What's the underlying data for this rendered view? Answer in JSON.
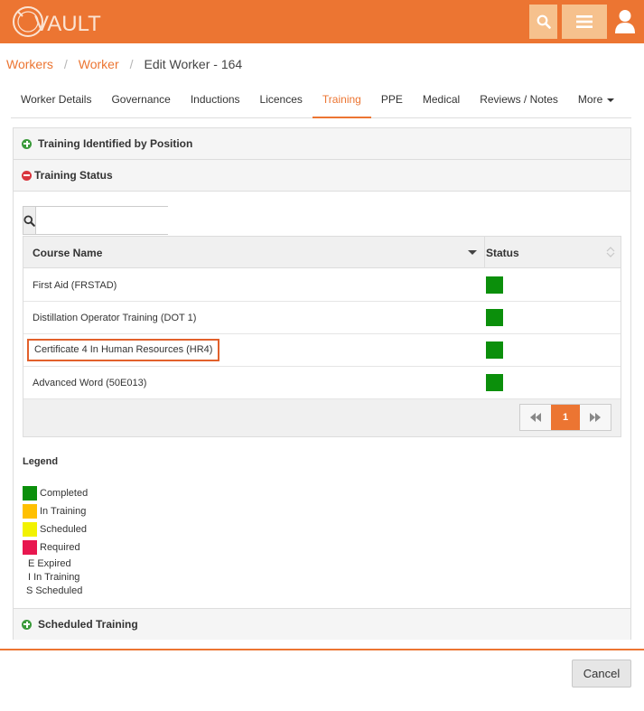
{
  "header": {
    "logo_text": "VAULT",
    "colors": {
      "brand": "#ec7532",
      "button_bg": "#f6c18d"
    },
    "icons": {
      "search": "search-icon",
      "menu": "hamburger-menu-icon",
      "user": "user-icon"
    }
  },
  "breadcrumb": {
    "items": [
      "Workers",
      "Worker"
    ],
    "separator": "/",
    "current": "Edit Worker - 164"
  },
  "tabs": [
    {
      "label": "Worker Details",
      "active": false
    },
    {
      "label": "Governance",
      "active": false
    },
    {
      "label": "Inductions",
      "active": false
    },
    {
      "label": "Licences",
      "active": false
    },
    {
      "label": "Training",
      "active": true
    },
    {
      "label": "PPE",
      "active": false
    },
    {
      "label": "Medical",
      "active": false
    },
    {
      "label": "Reviews / Notes",
      "active": false
    },
    {
      "label": "More",
      "active": false
    }
  ],
  "sections": {
    "identified": {
      "title": "Training Identified by Position",
      "expanded": false
    },
    "status": {
      "title": "Training Status",
      "expanded": true
    },
    "scheduled": {
      "title": "Scheduled Training",
      "expanded": false
    }
  },
  "search": {
    "value": "",
    "placeholder": ""
  },
  "grid": {
    "columns": {
      "course": "Course Name",
      "status": "Status"
    },
    "rows": [
      {
        "course": "First Aid (FRSTAD)",
        "status": "Completed",
        "status_color": "#0b8f0b"
      },
      {
        "course": "Distillation Operator Training (DOT 1)",
        "status": "Completed",
        "status_color": "#0b8f0b"
      },
      {
        "course": "Certificate 4 In Human Resources (HR4)",
        "status": "Completed",
        "status_color": "#0b8f0b",
        "highlighted": true
      },
      {
        "course": "Advanced Word (50E013)",
        "status": "Completed",
        "status_color": "#0b8f0b"
      }
    ],
    "pager": {
      "current_page": "1"
    }
  },
  "legend": {
    "title": "Legend",
    "colors": [
      {
        "label": "Completed",
        "color": "#0b8f0b"
      },
      {
        "label": "In Training",
        "color": "#ffc000"
      },
      {
        "label": "Scheduled",
        "color": "#f2f200"
      },
      {
        "label": "Required",
        "color": "#e8174f"
      }
    ],
    "codes": [
      {
        "code": "E",
        "label": "Expired"
      },
      {
        "code": "I",
        "label": "In Training"
      },
      {
        "code": "S",
        "label": "Scheduled"
      }
    ]
  },
  "footer": {
    "cancel_label": "Cancel"
  }
}
